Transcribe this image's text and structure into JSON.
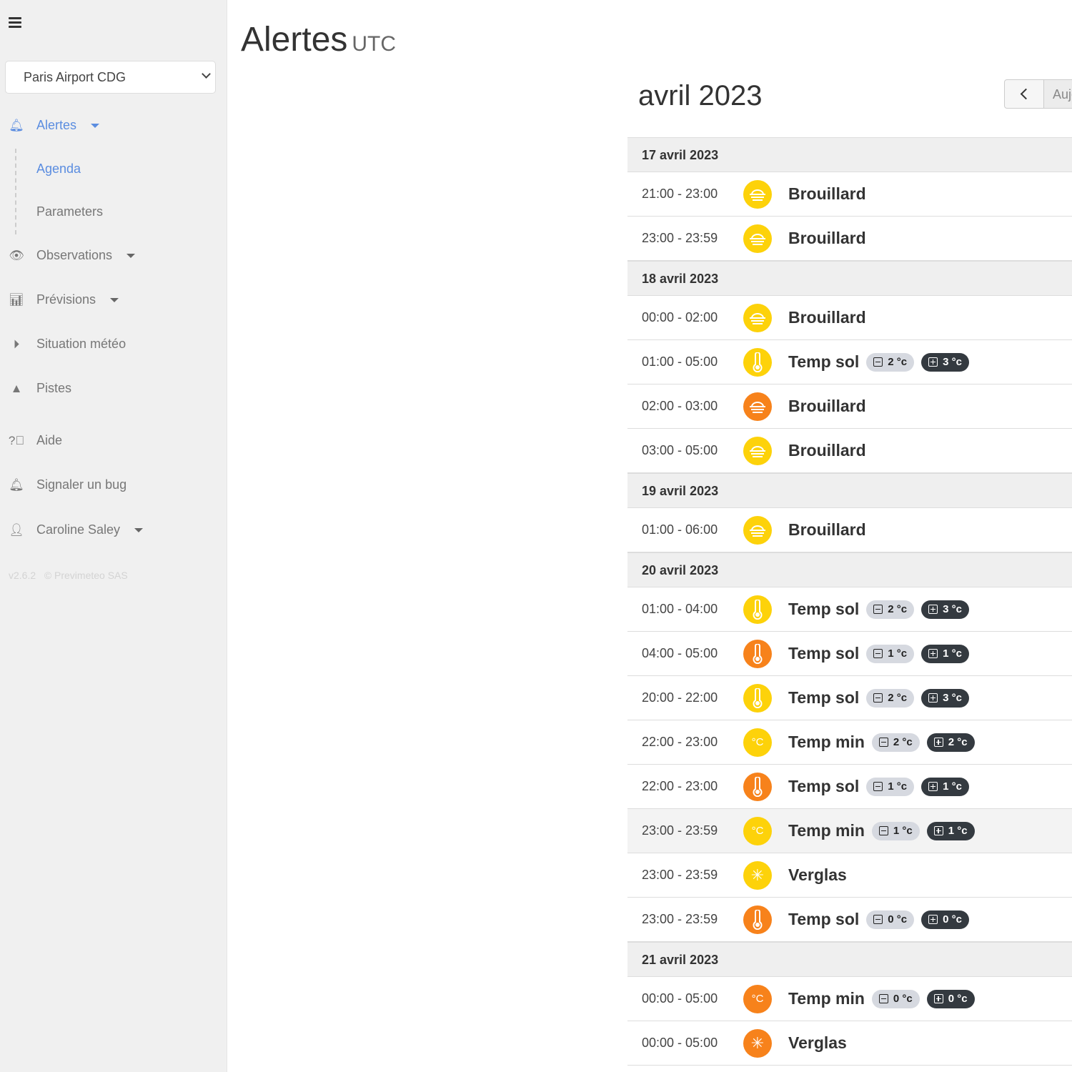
{
  "colors": {
    "yellow": "#fdd20a",
    "orange": "#f7821b",
    "accent": "#5b8de0"
  },
  "sidebar": {
    "site": "Paris Airport CDG",
    "items": [
      {
        "label": "Alertes",
        "icon": "bell-icon"
      },
      {
        "label": "Observations",
        "icon": "eye-icon"
      },
      {
        "label": "Prévisions",
        "icon": "bar-chart-icon"
      },
      {
        "label": "Situation météo",
        "icon": "play-circle-icon"
      },
      {
        "label": "Pistes",
        "icon": "road-icon"
      },
      {
        "label": "Aide",
        "icon": "question-circle-icon"
      },
      {
        "label": "Signaler un bug",
        "icon": "bell-icon"
      },
      {
        "label": "Caroline Saley",
        "icon": "user-icon"
      }
    ],
    "subitems": [
      {
        "label": "Agenda"
      },
      {
        "label": "Parameters"
      }
    ],
    "version": "v2.6.2",
    "copyright": "© Previmeteo SAS"
  },
  "header": {
    "title": "Alertes",
    "tz": "UTC"
  },
  "calendar": {
    "month": "avril 2023",
    "today_label": "Aujourd'hui",
    "days": [
      {
        "date": "17 avril 2023",
        "events": [
          {
            "time": "21:00 - 23:00",
            "type": "fog",
            "level": "yellow",
            "label": "Brouillard"
          },
          {
            "time": "23:00 - 23:59",
            "type": "fog",
            "level": "yellow",
            "label": "Brouillard"
          }
        ]
      },
      {
        "date": "18 avril 2023",
        "events": [
          {
            "time": "00:00 - 02:00",
            "type": "fog",
            "level": "yellow",
            "label": "Brouillard"
          },
          {
            "time": "01:00 - 05:00",
            "type": "thermo",
            "level": "yellow",
            "label": "Temp sol",
            "min": "2 °c",
            "max": "3 °c"
          },
          {
            "time": "02:00 - 03:00",
            "type": "fog",
            "level": "orange",
            "label": "Brouillard"
          },
          {
            "time": "03:00 - 05:00",
            "type": "fog",
            "level": "yellow",
            "label": "Brouillard"
          }
        ]
      },
      {
        "date": "19 avril 2023",
        "events": [
          {
            "time": "01:00 - 06:00",
            "type": "fog",
            "level": "yellow",
            "label": "Brouillard"
          }
        ]
      },
      {
        "date": "20 avril 2023",
        "events": [
          {
            "time": "01:00 - 04:00",
            "type": "thermo",
            "level": "yellow",
            "label": "Temp sol",
            "min": "2 °c",
            "max": "3 °c"
          },
          {
            "time": "04:00 - 05:00",
            "type": "thermo",
            "level": "orange",
            "label": "Temp sol",
            "min": "1 °c",
            "max": "1 °c"
          },
          {
            "time": "20:00 - 22:00",
            "type": "thermo",
            "level": "yellow",
            "label": "Temp sol",
            "min": "2 °c",
            "max": "3 °c"
          },
          {
            "time": "22:00 - 23:00",
            "type": "celsius",
            "level": "yellow",
            "label": "Temp min",
            "min": "2 °c",
            "max": "2 °c"
          },
          {
            "time": "22:00 - 23:00",
            "type": "thermo",
            "level": "orange",
            "label": "Temp sol",
            "min": "1 °c",
            "max": "1 °c"
          },
          {
            "time": "23:00 - 23:59",
            "type": "celsius",
            "level": "yellow",
            "label": "Temp min",
            "min": "1 °c",
            "max": "1 °c",
            "highlight": true
          },
          {
            "time": "23:00 - 23:59",
            "type": "ice",
            "level": "yellow",
            "label": "Verglas"
          },
          {
            "time": "23:00 - 23:59",
            "type": "thermo",
            "level": "orange",
            "label": "Temp sol",
            "min": "0 °c",
            "max": "0 °c"
          }
        ]
      },
      {
        "date": "21 avril 2023",
        "events": [
          {
            "time": "00:00 - 05:00",
            "type": "celsius",
            "level": "orange",
            "label": "Temp min",
            "min": "0 °c",
            "max": "0 °c"
          },
          {
            "time": "00:00 - 05:00",
            "type": "ice",
            "level": "orange",
            "label": "Verglas"
          }
        ]
      }
    ]
  }
}
